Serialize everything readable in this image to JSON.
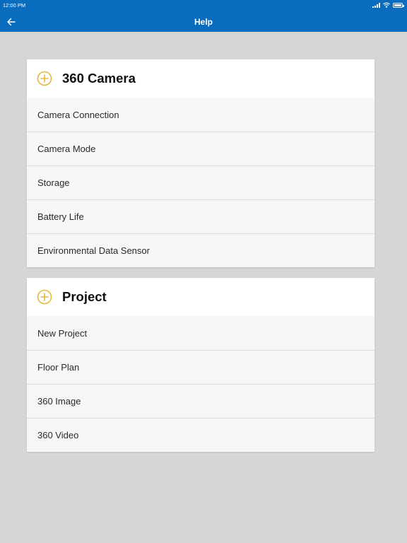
{
  "status_bar": {
    "time": "12:00 PM"
  },
  "header": {
    "title": "Help",
    "back_icon": "arrow-left-icon"
  },
  "colors": {
    "appbar": "#0a6cbd",
    "background": "#d6d6d6",
    "accent_icon": "#e2b93b"
  },
  "sections": [
    {
      "title": "360 Camera",
      "icon": "plus-circle-icon",
      "items": [
        {
          "label": "Camera Connection"
        },
        {
          "label": "Camera Mode"
        },
        {
          "label": "Storage"
        },
        {
          "label": "Battery Life"
        },
        {
          "label": "Environmental Data Sensor"
        }
      ]
    },
    {
      "title": "Project",
      "icon": "plus-circle-icon",
      "items": [
        {
          "label": "New Project"
        },
        {
          "label": "Floor Plan"
        },
        {
          "label": "360 Image"
        },
        {
          "label": "360 Video"
        }
      ]
    }
  ]
}
